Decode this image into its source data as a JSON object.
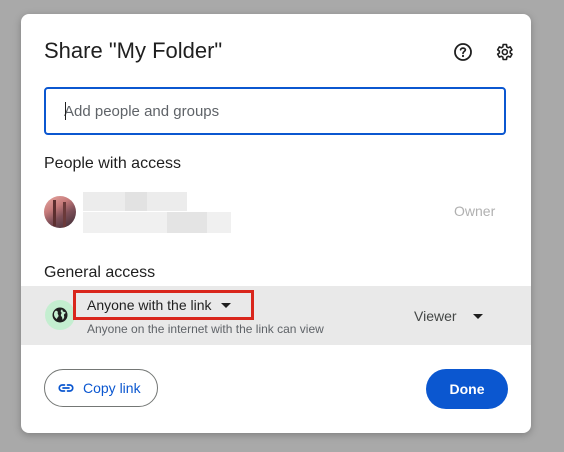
{
  "dialog": {
    "title": "Share \"My Folder\"",
    "help_icon": "help-circle-icon",
    "settings_icon": "gear-icon"
  },
  "search": {
    "placeholder": "Add people and groups",
    "value": ""
  },
  "people": {
    "section_label": "People with access",
    "items": [
      {
        "role": "Owner",
        "avatar": "user-avatar"
      }
    ]
  },
  "general_access": {
    "section_label": "General access",
    "icon": "globe-icon",
    "selected": "Anyone with the link",
    "description": "Anyone on the internet with the link can view",
    "role": "Viewer"
  },
  "footer": {
    "copy_label": "Copy link",
    "copy_icon": "link-icon",
    "done_label": "Done"
  },
  "colors": {
    "accent": "#0b57d0",
    "highlight_box": "#d9261c",
    "globe_bg": "#c4eed0"
  }
}
